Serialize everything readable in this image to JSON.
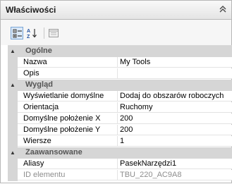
{
  "panel": {
    "title": "Właściwości",
    "collapse_icon": "double-chevron-up-icon"
  },
  "toolbar": {
    "buttons": [
      {
        "name": "categorized-view",
        "icon": "categorized-icon",
        "active": true
      },
      {
        "name": "alphabetical-sort",
        "icon": "sort-az-icon",
        "active": false
      },
      {
        "name": "property-pages",
        "icon": "property-pages-icon",
        "active": false
      }
    ]
  },
  "categories": {
    "general": {
      "label": "Ogólne",
      "props": [
        {
          "name": "Nazwa",
          "value": "My Tools"
        },
        {
          "name": "Opis",
          "value": ""
        }
      ]
    },
    "appearance": {
      "label": "Wygląd",
      "props": [
        {
          "name": "Wyświetlanie domyślne",
          "value": "Dodaj do obszarów roboczych"
        },
        {
          "name": "Orientacja",
          "value": "Ruchomy"
        },
        {
          "name": "Domyślne położenie X",
          "value": "200"
        },
        {
          "name": "Domyślne położenie Y",
          "value": "200"
        },
        {
          "name": "Wiersze",
          "value": "1"
        }
      ]
    },
    "advanced": {
      "label": "Zaawansowane",
      "props": [
        {
          "name": "Aliasy",
          "value": "PasekNarzędzi1"
        },
        {
          "name": "ID elementu",
          "value": "TBU_220_AC9A8",
          "disabled": true
        }
      ]
    }
  }
}
